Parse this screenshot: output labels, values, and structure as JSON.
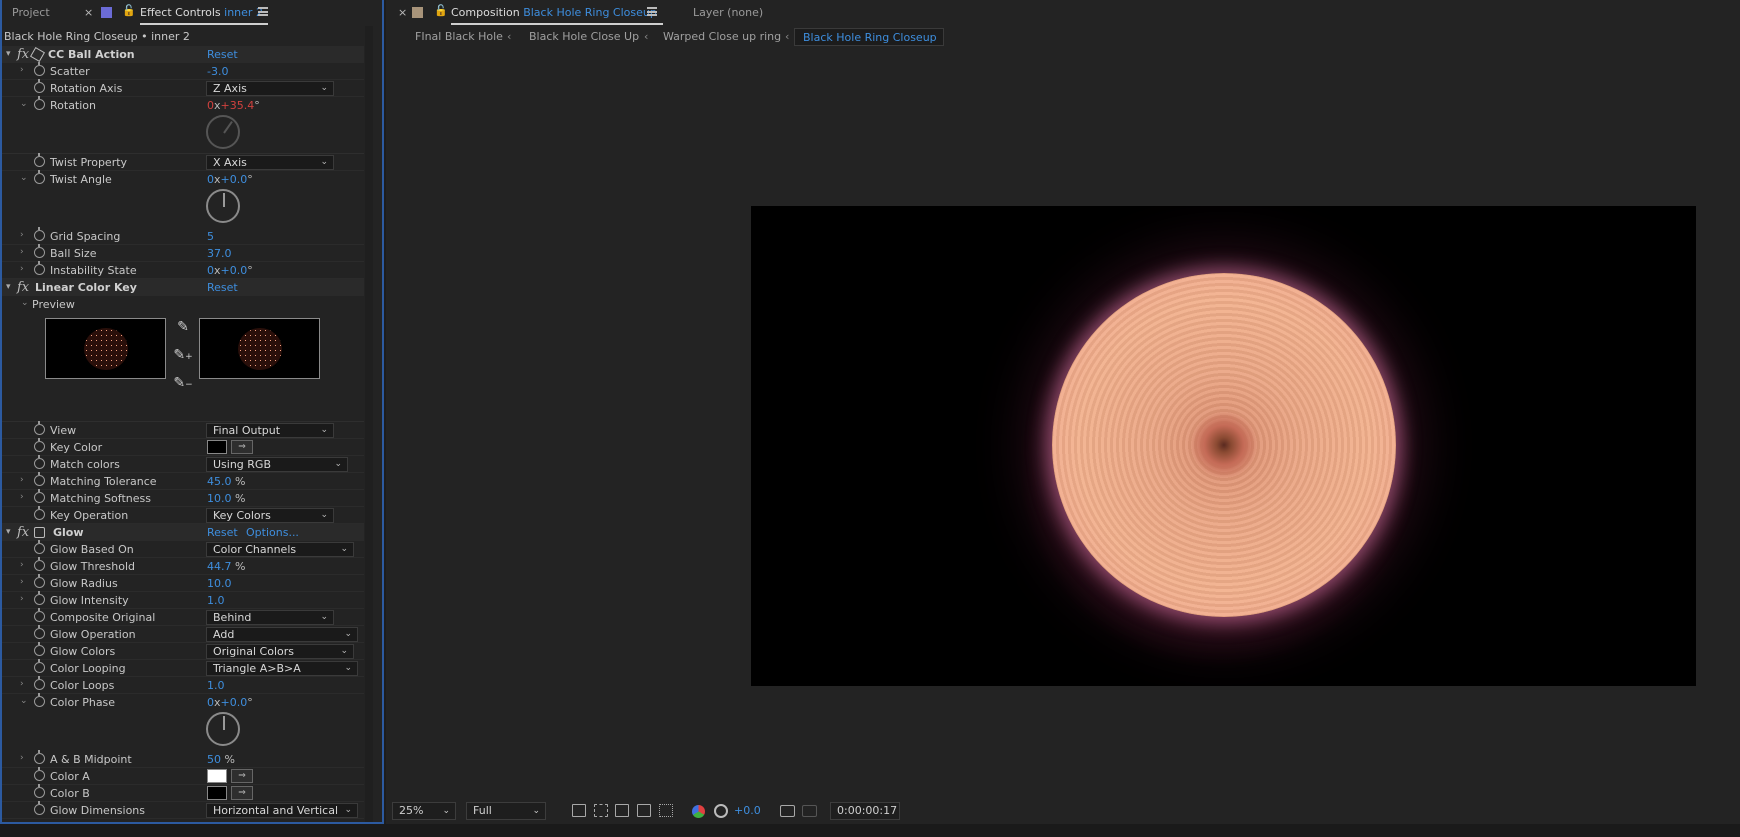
{
  "left_panel": {
    "tab_project": "Project",
    "tab_close": "×",
    "tab_effect_controls": "Effect Controls",
    "tab_effect_layer": "inner 2",
    "breadcrumb": "Black Hole Ring Closeup • inner 2",
    "effects": [
      {
        "name": "CC Ball Action",
        "reset": "Reset"
      },
      {
        "name": "Linear Color Key",
        "reset": "Reset"
      },
      {
        "name": "Glow",
        "reset": "Reset",
        "options": "Options..."
      }
    ],
    "cc_ball_action": {
      "scatter_label": "Scatter",
      "scatter_value": "-3.0",
      "rotation_axis_label": "Rotation Axis",
      "rotation_axis_value": "Z Axis",
      "rotation_label": "Rotation",
      "rotation_rev": "0",
      "rotation_x": "x",
      "rotation_deg": "+35.4",
      "rotation_unit": "°",
      "twist_property_label": "Twist Property",
      "twist_property_value": "X Axis",
      "twist_angle_label": "Twist Angle",
      "twist_angle_rev": "0",
      "twist_angle_x": "x",
      "twist_angle_deg": "+0.0",
      "twist_angle_unit": "°",
      "grid_spacing_label": "Grid Spacing",
      "grid_spacing_value": "5",
      "ball_size_label": "Ball Size",
      "ball_size_value": "37.0",
      "instability_label": "Instability State",
      "instability_rev": "0",
      "instability_x": "x",
      "instability_deg": "+0.0",
      "instability_unit": "°"
    },
    "linear_color_key": {
      "preview_label": "Preview",
      "view_label": "View",
      "view_value": "Final Output",
      "key_color_label": "Key Color",
      "match_colors_label": "Match colors",
      "match_colors_value": "Using RGB",
      "matching_tolerance_label": "Matching Tolerance",
      "matching_tolerance_value": "45.0",
      "matching_tolerance_unit": "%",
      "matching_softness_label": "Matching Softness",
      "matching_softness_value": "10.0",
      "matching_softness_unit": "%",
      "key_operation_label": "Key Operation",
      "key_operation_value": "Key Colors"
    },
    "glow": {
      "glow_based_on_label": "Glow Based On",
      "glow_based_on_value": "Color Channels",
      "glow_threshold_label": "Glow Threshold",
      "glow_threshold_value": "44.7",
      "glow_threshold_unit": "%",
      "glow_radius_label": "Glow Radius",
      "glow_radius_value": "10.0",
      "glow_intensity_label": "Glow Intensity",
      "glow_intensity_value": "1.0",
      "composite_original_label": "Composite Original",
      "composite_original_value": "Behind",
      "glow_operation_label": "Glow Operation",
      "glow_operation_value": "Add",
      "glow_colors_label": "Glow Colors",
      "glow_colors_value": "Original Colors",
      "color_looping_label": "Color Looping",
      "color_looping_value": "Triangle A>B>A",
      "color_loops_label": "Color Loops",
      "color_loops_value": "1.0",
      "color_phase_label": "Color Phase",
      "color_phase_rev": "0",
      "color_phase_x": "x",
      "color_phase_deg": "+0.0",
      "color_phase_unit": "°",
      "ab_midpoint_label": "A & B Midpoint",
      "ab_midpoint_value": "50",
      "ab_midpoint_unit": "%",
      "color_a_label": "Color A",
      "color_b_label": "Color B",
      "glow_dimensions_label": "Glow Dimensions",
      "glow_dimensions_value": "Horizontal and Vertical"
    }
  },
  "right_panel": {
    "tab_close": "×",
    "tab_composition": "Composition",
    "tab_comp_name": "Black Hole Ring Closeup",
    "tab_layer": "Layer  (none)",
    "breadcrumbs": [
      "FInal Black Hole",
      "Black Hole Close Up",
      "Warped Close up ring",
      "Black Hole Ring Closeup"
    ],
    "crumb_sep": "‹",
    "zoom": "25%",
    "resolution": "Full",
    "exposure": "+0.0",
    "timecode": "0:00:00:17"
  },
  "colors": {
    "accent_blue": "#3e8ede",
    "value_red": "#d1413e",
    "color_a": "#ffffff",
    "color_b": "#000000",
    "key_color": "#000000"
  }
}
